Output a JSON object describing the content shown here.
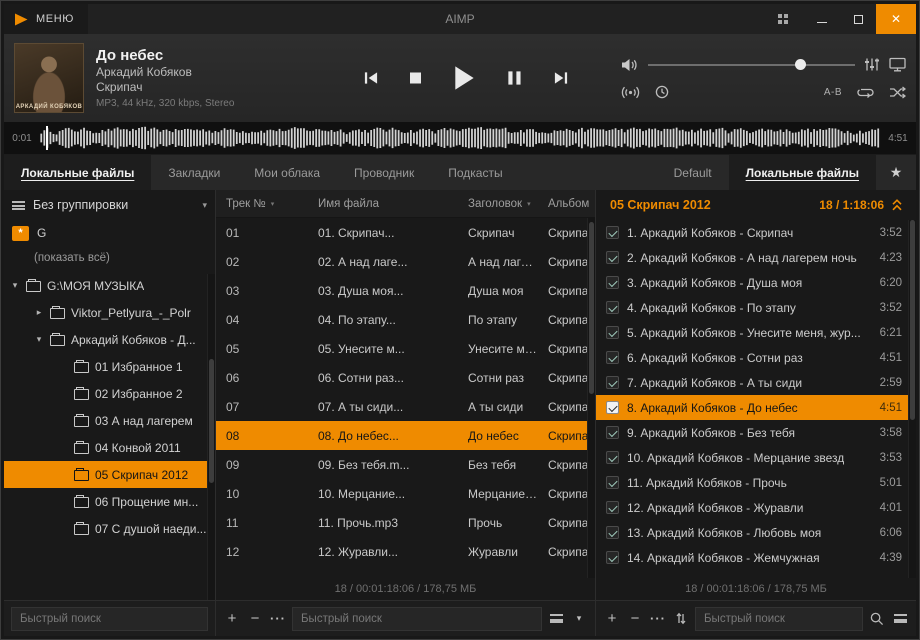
{
  "colors": {
    "accent": "#ef8b00"
  },
  "icons": {
    "close": "✕",
    "star": "★",
    "caret_down": "▾",
    "tree_open": "▾",
    "tree_closed": "▸",
    "add": "+",
    "remove": "−",
    "more": "···"
  },
  "titlebar": {
    "menu": "МЕНЮ",
    "title": "AIMP"
  },
  "player": {
    "track_title": "До небес",
    "artist": "Аркадий Кобяков",
    "album": "Скрипач",
    "format": "MP3, 44 kHz, 320 kbps, Stereo",
    "art_caption": "АРКАДИЙ КОБЯКОВ",
    "elapsed": "0:01",
    "remaining": "4:51",
    "ab_label": "A-B",
    "volume_percent": 74
  },
  "nav_tabs": [
    {
      "label": "Локальные файлы",
      "active": true
    },
    {
      "label": "Закладки",
      "active": false
    },
    {
      "label": "Мои облака",
      "active": false
    },
    {
      "label": "Проводник",
      "active": false
    },
    {
      "label": "Подкасты",
      "active": false
    }
  ],
  "playlist_tabs": [
    {
      "label": "Default",
      "active": false
    },
    {
      "label": "Локальные файлы",
      "active": true
    }
  ],
  "sidebar": {
    "grouping": "Без группировки",
    "badge": "*",
    "drive_label": "G",
    "show_all": "(показать всё)",
    "search_placeholder": "Быстрый поиск",
    "tree": [
      {
        "label": "G:\\МОЯ МУЗЫКА",
        "depth": 0,
        "expand": "open",
        "selected": false
      },
      {
        "label": "Viktor_Petlyura_-_Polr",
        "depth": 1,
        "expand": "closed",
        "selected": false
      },
      {
        "label": "Аркадий Кобяков - Д...",
        "depth": 1,
        "expand": "open",
        "selected": false
      },
      {
        "label": "01 Избранное 1",
        "depth": 2,
        "expand": "",
        "selected": false
      },
      {
        "label": "02 Избранное 2",
        "depth": 2,
        "expand": "",
        "selected": false
      },
      {
        "label": "03 А над лагерем",
        "depth": 2,
        "expand": "",
        "selected": false
      },
      {
        "label": "04 Конвой 2011",
        "depth": 2,
        "expand": "",
        "selected": false
      },
      {
        "label": "05 Скрипач 2012",
        "depth": 2,
        "expand": "",
        "selected": true
      },
      {
        "label": "06 Прощение мн...",
        "depth": 2,
        "expand": "",
        "selected": false
      },
      {
        "label": "07 С душой наеди...",
        "depth": 2,
        "expand": "",
        "selected": false
      }
    ]
  },
  "table": {
    "columns": [
      "Трек №",
      "Имя файла",
      "Заголовок",
      "Альбом"
    ],
    "rows": [
      {
        "num": "01",
        "file": "01. Скрипач...",
        "title": "Скрипач",
        "album": "Скрипач",
        "selected": false
      },
      {
        "num": "02",
        "file": "02. А над лаге...",
        "title": "А над лагере...",
        "album": "Скрипач",
        "selected": false
      },
      {
        "num": "03",
        "file": "03. Душа моя...",
        "title": "Душа моя",
        "album": "Скрипач",
        "selected": false
      },
      {
        "num": "04",
        "file": "04. По этапу...",
        "title": "По этапу",
        "album": "Скрипач",
        "selected": false
      },
      {
        "num": "05",
        "file": "05. Унесите м...",
        "title": "Унесите меня,...",
        "album": "Скрипач",
        "selected": false
      },
      {
        "num": "06",
        "file": "06. Сотни раз...",
        "title": "Сотни раз",
        "album": "Скрипач",
        "selected": false
      },
      {
        "num": "07",
        "file": "07. А ты сиди...",
        "title": "А ты сиди",
        "album": "Скрипач",
        "selected": false
      },
      {
        "num": "08",
        "file": "08. До небес...",
        "title": "До небес",
        "album": "Скрипач",
        "selected": true
      },
      {
        "num": "09",
        "file": "09. Без тебя.m...",
        "title": "Без тебя",
        "album": "Скрипач",
        "selected": false
      },
      {
        "num": "10",
        "file": "10. Мерцание...",
        "title": "Мерцание зв...",
        "album": "Скрипач",
        "selected": false
      },
      {
        "num": "11",
        "file": "11. Прочь.mp3",
        "title": "Прочь",
        "album": "Скрипач",
        "selected": false
      },
      {
        "num": "12",
        "file": "12. Журавли...",
        "title": "Журавли",
        "album": "Скрипач",
        "selected": false
      }
    ],
    "status": "18 / 00:01:18:06 / 178,75 МБ",
    "search_placeholder": "Быстрый поиск"
  },
  "playlist": {
    "title": "05 Скрипач 2012",
    "summary": "18 / 1:18:06",
    "items": [
      {
        "label": "1. Аркадий Кобяков - Скрипач",
        "time": "3:52",
        "checked": true,
        "selected": false
      },
      {
        "label": "2. Аркадий Кобяков - А над лагерем ночь",
        "time": "4:23",
        "checked": true,
        "selected": false
      },
      {
        "label": "3. Аркадий Кобяков - Душа моя",
        "time": "6:20",
        "checked": true,
        "selected": false
      },
      {
        "label": "4. Аркадий Кобяков - По этапу",
        "time": "3:52",
        "checked": true,
        "selected": false
      },
      {
        "label": "5. Аркадий Кобяков - Унесите меня, жур...",
        "time": "6:21",
        "checked": true,
        "selected": false
      },
      {
        "label": "6. Аркадий Кобяков - Сотни раз",
        "time": "4:51",
        "checked": true,
        "selected": false
      },
      {
        "label": "7. Аркадий Кобяков - А ты сиди",
        "time": "2:59",
        "checked": true,
        "selected": false
      },
      {
        "label": "8. Аркадий Кобяков - До небес",
        "time": "4:51",
        "checked": true,
        "selected": true
      },
      {
        "label": "9. Аркадий Кобяков - Без тебя",
        "time": "3:58",
        "checked": true,
        "selected": false
      },
      {
        "label": "10. Аркадий Кобяков - Мерцание звезд",
        "time": "3:53",
        "checked": true,
        "selected": false
      },
      {
        "label": "11. Аркадий Кобяков - Прочь",
        "time": "5:01",
        "checked": true,
        "selected": false
      },
      {
        "label": "12. Аркадий Кобяков - Журавли",
        "time": "4:01",
        "checked": true,
        "selected": false
      },
      {
        "label": "13. Аркадий Кобяков - Любовь моя",
        "time": "6:06",
        "checked": true,
        "selected": false
      },
      {
        "label": "14. Аркадий Кобяков - Жемчужная",
        "time": "4:39",
        "checked": true,
        "selected": false
      }
    ],
    "status": "18 / 00:01:18:06 / 178,75 МБ",
    "search_placeholder": "Быстрый поиск"
  }
}
